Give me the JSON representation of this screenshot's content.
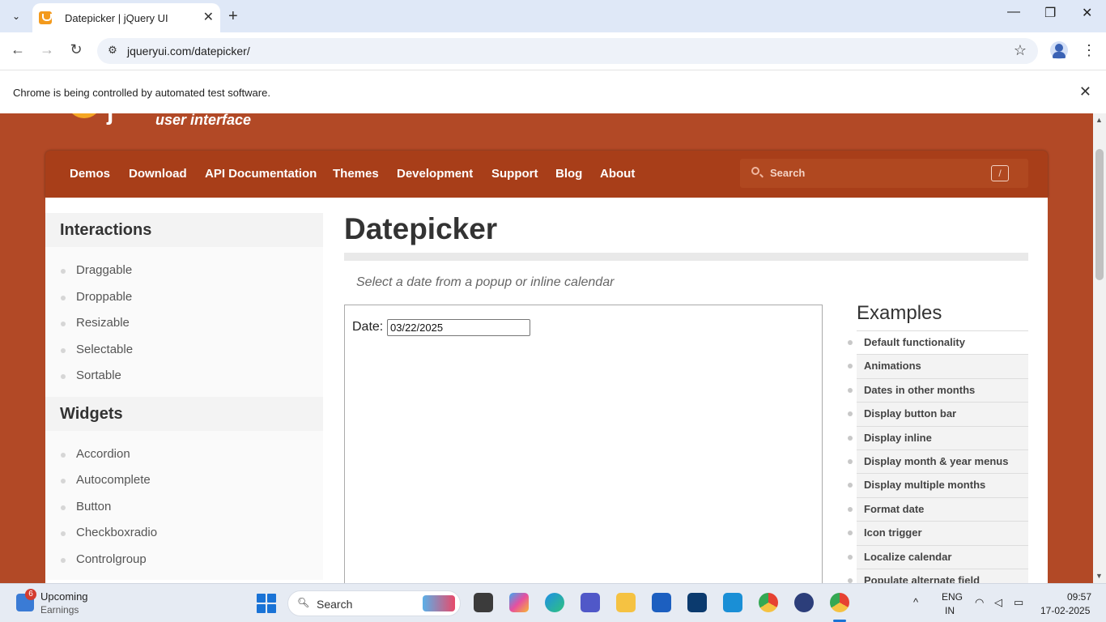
{
  "browser": {
    "tab_title": "Datepicker | jQuery UI",
    "url": "jqueryui.com/datepicker/",
    "infobar_message": "Chrome is being controlled by automated test software."
  },
  "site": {
    "tagline": "user interface",
    "nav": [
      "Demos",
      "Download",
      "API Documentation",
      "Themes",
      "Development",
      "Support",
      "Blog",
      "About"
    ],
    "search_placeholder": "Search",
    "search_shortcut": "/"
  },
  "sidebar": {
    "sections": [
      {
        "heading": "Interactions",
        "items": [
          "Draggable",
          "Droppable",
          "Resizable",
          "Selectable",
          "Sortable"
        ]
      },
      {
        "heading": "Widgets",
        "items": [
          "Accordion",
          "Autocomplete",
          "Button",
          "Checkboxradio",
          "Controlgroup"
        ]
      }
    ]
  },
  "main": {
    "title": "Datepicker",
    "description": "Select a date from a popup or inline calendar",
    "demo": {
      "label": "Date:",
      "value": "03/22/2025"
    },
    "examples_heading": "Examples",
    "examples": [
      "Default functionality",
      "Animations",
      "Dates in other months",
      "Display button bar",
      "Display inline",
      "Display month & year menus",
      "Display multiple months",
      "Format date",
      "Icon trigger",
      "Localize calendar",
      "Populate alternate field"
    ]
  },
  "taskbar": {
    "notification_count": "6",
    "widget_title": "Upcoming",
    "widget_subtitle": "Earnings",
    "search_placeholder": "Search",
    "lang_primary": "ENG",
    "lang_secondary": "IN",
    "time": "09:57",
    "date": "17-02-2025"
  },
  "colors": {
    "brand": "#b24926",
    "nav_bg": "#a83e19",
    "accent": "#f5a623"
  }
}
